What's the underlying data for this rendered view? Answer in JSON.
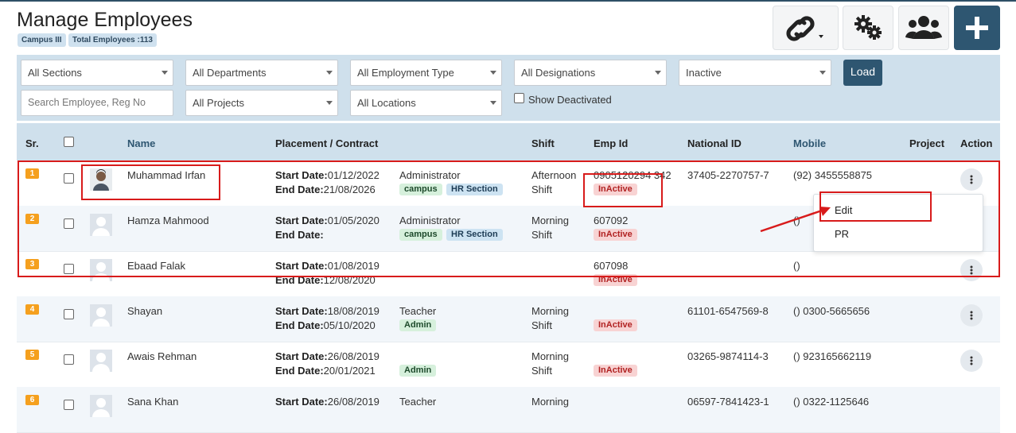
{
  "page": {
    "title": "Manage Employees",
    "badges": [
      "Campus III",
      "Total Employees :113"
    ]
  },
  "toolbar": {
    "link_icon": "link-icon",
    "settings_icon": "gears-icon",
    "users_icon": "users-icon",
    "add_icon": "plus-icon"
  },
  "filters": {
    "sections": "All Sections",
    "departments": "All Departments",
    "employment_type": "All Employment Type",
    "designations": "All Designations",
    "status": "Inactive",
    "search_placeholder": "Search Employee, Reg No",
    "projects": "All Projects",
    "locations": "All Locations",
    "show_deactivated": "Show Deactivated",
    "load": "Load"
  },
  "table": {
    "headers": {
      "sr": "Sr.",
      "name": "Name",
      "placement": "Placement / Contract",
      "shift": "Shift",
      "emp_id": "Emp Id",
      "national_id": "National ID",
      "mobile": "Mobile",
      "project": "Project",
      "action": "Action"
    },
    "labels": {
      "start": "Start Date:",
      "end": "End Date:"
    },
    "rows": [
      {
        "sr": "1",
        "name": "Muhammad Irfan",
        "start": "01/12/2022",
        "end": "21/08/2026",
        "designation": "Administrator",
        "tag1": "campus",
        "tag2": "HR Section",
        "shift1": "Afternoon",
        "shift2": "Shift",
        "emp_id": "0905120294 342",
        "status": "InActive",
        "national_id": "37405-2270757-7",
        "mobile": "(92) 3455558875"
      },
      {
        "sr": "2",
        "name": "Hamza Mahmood",
        "start": "01/05/2020",
        "end": "",
        "designation": "Administrator",
        "tag1": "campus",
        "tag2": "HR Section",
        "shift1": "Morning",
        "shift2": "Shift",
        "emp_id": "607092",
        "status": "InActive",
        "national_id": "",
        "mobile": "()"
      },
      {
        "sr": "3",
        "name": "Ebaad Falak",
        "start": "01/08/2019",
        "end": "12/08/2020",
        "designation": "",
        "tag1": "",
        "tag2": "",
        "shift1": "",
        "shift2": "",
        "emp_id": "607098",
        "status": "InActive",
        "national_id": "",
        "mobile": "()"
      },
      {
        "sr": "4",
        "name": "Shayan",
        "start": "18/08/2019",
        "end": "05/10/2020",
        "designation": "Teacher",
        "tag1": "Admin",
        "tag2": "",
        "shift1": "Morning",
        "shift2": "Shift",
        "emp_id": "",
        "status": "InActive",
        "national_id": "61101-6547569-8",
        "mobile": "() 0300-5665656"
      },
      {
        "sr": "5",
        "name": "Awais Rehman",
        "start": "26/08/2019",
        "end": "20/01/2021",
        "designation": "",
        "tag1": "Admin",
        "tag2": "",
        "shift1": "Morning",
        "shift2": "Shift",
        "emp_id": "",
        "status": "InActive",
        "national_id": "03265-9874114-3",
        "mobile": "() 923165662119"
      },
      {
        "sr": "6",
        "name": "Sana Khan",
        "start": "26/08/2019",
        "end": "",
        "designation": "Teacher",
        "tag1": "",
        "tag2": "",
        "shift1": "Morning",
        "shift2": "",
        "emp_id": "",
        "status": "",
        "national_id": "06597-7841423-1",
        "mobile": "() 0322-1125646"
      }
    ]
  },
  "action_menu": {
    "edit": "Edit",
    "pr": "PR"
  },
  "colors": {
    "primary": "#2e5671",
    "header_bg": "#cfe0ec",
    "sr_badge": "#f5a01e",
    "annotation": "#d81b1b"
  }
}
